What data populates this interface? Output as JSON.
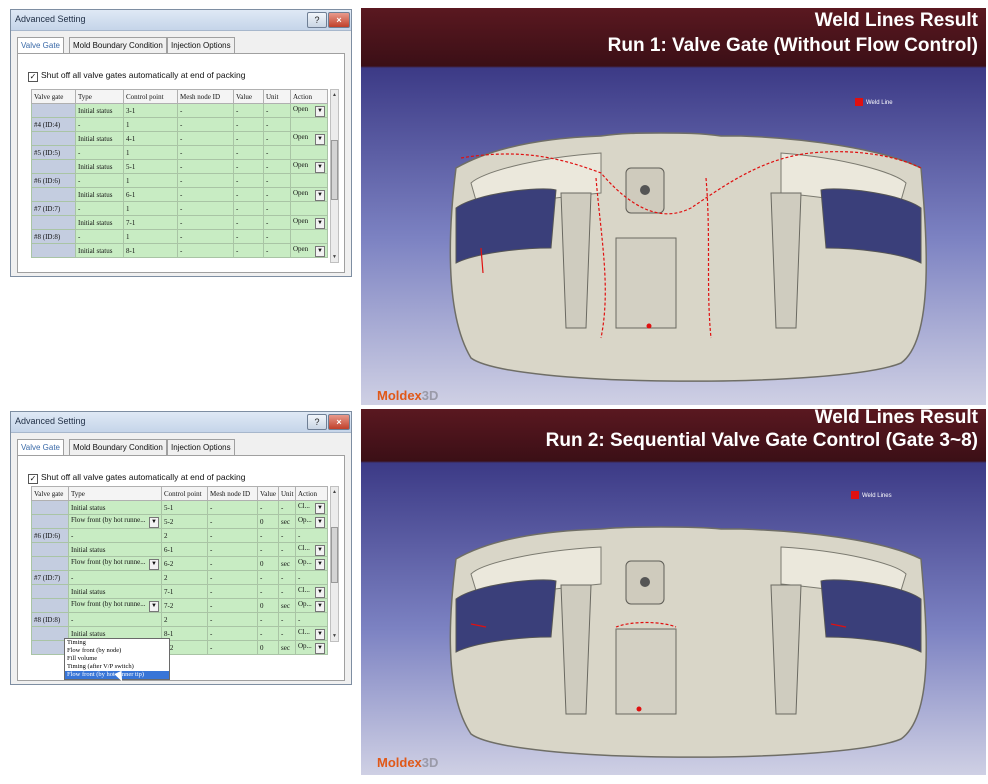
{
  "dialog1": {
    "title": "Advanced Setting",
    "tabs": [
      "Valve Gate",
      "Mold Boundary Condition",
      "Injection Options"
    ],
    "checkbox_label": "Shut off all valve gates automatically at end of packing",
    "checkbox_checked": true,
    "columns": [
      "Valve gate",
      "Type",
      "Control point",
      "Mesh node ID",
      "Value",
      "Unit",
      "Action"
    ],
    "rows": [
      [
        "",
        "Initial status",
        "3-1",
        "-",
        "-",
        "-",
        "Open"
      ],
      [
        "#4 (ID:4)",
        "-",
        "1",
        "-",
        "-",
        "-",
        ""
      ],
      [
        "",
        "Initial status",
        "4-1",
        "-",
        "-",
        "-",
        "Open"
      ],
      [
        "#5 (ID:5)",
        "-",
        "1",
        "-",
        "-",
        "-",
        ""
      ],
      [
        "",
        "Initial status",
        "5-1",
        "-",
        "-",
        "-",
        "Open"
      ],
      [
        "#6 (ID:6)",
        "-",
        "1",
        "-",
        "-",
        "-",
        ""
      ],
      [
        "",
        "Initial status",
        "6-1",
        "-",
        "-",
        "-",
        "Open"
      ],
      [
        "#7 (ID:7)",
        "-",
        "1",
        "-",
        "-",
        "-",
        ""
      ],
      [
        "",
        "Initial status",
        "7-1",
        "-",
        "-",
        "-",
        "Open"
      ],
      [
        "#8 (ID:8)",
        "-",
        "1",
        "-",
        "-",
        "-",
        ""
      ],
      [
        "",
        "Initial status",
        "8-1",
        "-",
        "-",
        "-",
        "Open"
      ]
    ]
  },
  "dialog2": {
    "title": "Advanced Setting",
    "tabs": [
      "Valve Gate",
      "Mold Boundary Condition",
      "Injection Options"
    ],
    "checkbox_label": "Shut off all valve gates automatically at end of packing",
    "checkbox_checked": true,
    "columns": [
      "Valve gate",
      "Type",
      "Control point",
      "Mesh node ID",
      "Value",
      "Unit",
      "Action"
    ],
    "rows": [
      [
        "",
        "Initial status",
        "5-1",
        "-",
        "-",
        "-",
        "Cl..."
      ],
      [
        "",
        "Flow front (by hot runne...",
        "5-2",
        "-",
        "0",
        "sec",
        "Op..."
      ],
      [
        "#6 (ID:6)",
        "-",
        "2",
        "-",
        "-",
        "-",
        "-"
      ],
      [
        "",
        "Initial status",
        "6-1",
        "-",
        "-",
        "-",
        "Cl..."
      ],
      [
        "",
        "Flow front (by hot runne...",
        "6-2",
        "-",
        "0",
        "sec",
        "Op..."
      ],
      [
        "#7 (ID:7)",
        "-",
        "2",
        "-",
        "-",
        "-",
        "-"
      ],
      [
        "",
        "Initial status",
        "7-1",
        "-",
        "-",
        "-",
        "Cl..."
      ],
      [
        "",
        "Flow front (by hot runne...",
        "7-2",
        "-",
        "0",
        "sec",
        "Op..."
      ],
      [
        "#8 (ID:8)",
        "-",
        "2",
        "-",
        "-",
        "-",
        "-"
      ],
      [
        "",
        "Initial status",
        "8-1",
        "-",
        "-",
        "-",
        "Cl..."
      ],
      [
        "",
        "Timing",
        "8-2",
        "-",
        "0",
        "sec",
        "Op..."
      ]
    ],
    "type_options": [
      "Timing",
      "Flow front (by node)",
      "Fill volume",
      "Timing (after V/P switch)",
      "Flow front (by hot runner tip)"
    ],
    "type_selected": "Flow front (by hot runner tip)"
  },
  "view1": {
    "title_line1": "Weld Lines Result",
    "title_line2": "Run 1: Valve Gate (Without Flow Control)",
    "legend_label": "Weld Line",
    "brand": "Moldex",
    "brand_suffix": "3D"
  },
  "view2": {
    "title_line1": "Weld Lines Result",
    "title_line2": "Run 2: Sequential Valve Gate Control (Gate 3~8)",
    "legend_label": "Weld Lines",
    "brand": "Moldex",
    "brand_suffix": "3D"
  },
  "colors": {
    "cell_green": "#c8ecc3",
    "title_bar_red": "#3b0f16",
    "weld_line": "#e01010",
    "brand_orange": "#e05818"
  }
}
